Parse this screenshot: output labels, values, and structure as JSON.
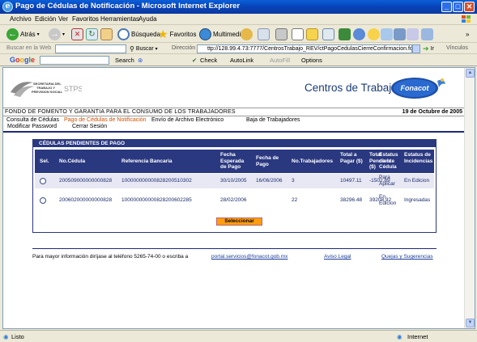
{
  "window": {
    "title": "Pago de Cédulas de Notificación - Microsoft Internet Explorer",
    "min": "_",
    "max": "□",
    "close": "✕"
  },
  "menu": [
    "Archivo",
    "Edición",
    "Ver",
    "Favoritos",
    "Herramientas",
    "Ayuda"
  ],
  "toolbar": {
    "back": "Atrás",
    "search": "Búsqueda",
    "favorites": "Favoritos",
    "multimedia": "Multimedia"
  },
  "searchbar": {
    "label": "Buscar en la Web",
    "buscar": "Buscar",
    "direccion": "Dirección",
    "url": "ttp://128.99.4.73:7777/CentrosTrabajo_REV/ctPagoCedulasCierreConfirmacion.fonacot",
    "ir": "Ir",
    "vinculos": "Vínculos"
  },
  "google": {
    "logo": "Google",
    "search": "Search",
    "check": "Check",
    "autolink": "AutoLink",
    "autofill": "AutoFill",
    "options": "Options"
  },
  "header": {
    "sec_lines": [
      "SECRETARIA DEL",
      "TRABAJO Y",
      "PREVISION SOCIAL"
    ],
    "stps": "STPS",
    "site_title": "Centros de Trabajo",
    "fonacot_logo": "Fonacot",
    "org": "FONDO DE FOMENTO Y GARANTIA PARA EL CONSUMO DE LOS TRABAJADORES",
    "date": "19 de Octubre de 2005"
  },
  "nav": {
    "consulta": "Consulta de Cédulas",
    "pago": "Pago de Cédulas de Notificación",
    "envio": "Envío de Archivo Electrónico",
    "baja": "Baja de Trabajadores",
    "modificar": "Modificar Password",
    "cerrar": "Cerrar Sesión"
  },
  "panel": {
    "title": "CÉDULAS PENDIENTES DE PAGO",
    "headers": {
      "sel": "Sel.",
      "no_cedula": "No.Cédula",
      "referencia": "Referencia Bancaria",
      "fecha_esperada": "Fecha Esperada de Pago",
      "fecha_pago": "Fecha de Pago",
      "no_trab": "No.Trabajadores",
      "total_pagar": "Total a Pagar ($)",
      "total_pend": "Total Pendiente ($)",
      "estatus_cedula": "Estatus de la Cédula",
      "estatus_inc": "Estatus de Incidencias"
    },
    "rows": [
      {
        "no_cedula": "200509000000000828",
        "referencia": "100000000000828200510302",
        "fecha_esperada": "30/10/2005",
        "fecha_pago": "16/06/2006",
        "no_trab": "3",
        "total_pagar": "10497.11",
        "total_pend": "-1502.89",
        "estatus_cedula": "Para Aplicar",
        "estatus_inc": "En Edicion"
      },
      {
        "no_cedula": "200602000000000828",
        "referencia": "100000000000828200602285",
        "fecha_esperada": "28/02/2006",
        "fecha_pago": "",
        "no_trab": "22",
        "total_pagar": "38296.48",
        "total_pend": "39208.92",
        "estatus_cedula": "En Edicion",
        "estatus_inc": "Ingresadas"
      }
    ],
    "button": "Seleccionar"
  },
  "footer": {
    "info": "Para mayor información diríjase al teléfono 5265-74-00 o escriba a",
    "email": "portal.servicios@fonacot.gob.mx",
    "aviso": "Aviso Legal",
    "quejas": "Quejas y Sugerencias"
  },
  "status": {
    "left": "Listo",
    "zone": "Internet"
  }
}
